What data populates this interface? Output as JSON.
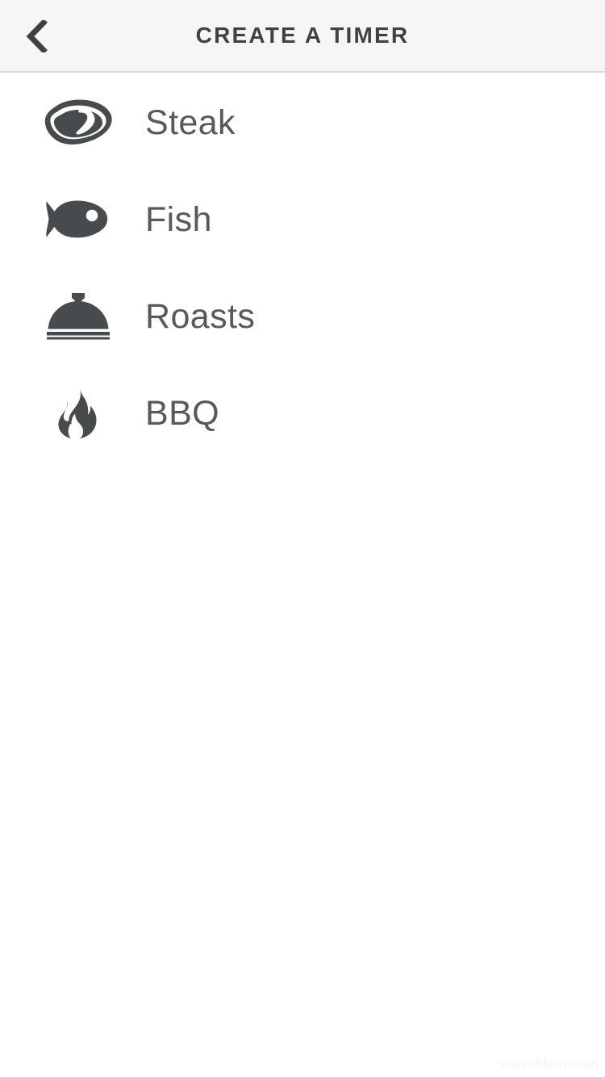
{
  "header": {
    "title": "CREATE A TIMER",
    "back_icon": "chevron-left-icon",
    "background_color": "#f6f6f6",
    "title_color": "#3f4245",
    "border_color": "#d9d9d9"
  },
  "list": {
    "items": [
      {
        "label": "Steak",
        "icon": "steak-icon",
        "icon_color": "#474b4e"
      },
      {
        "label": "Fish",
        "icon": "fish-icon",
        "icon_color": "#474b4e"
      },
      {
        "label": "Roasts",
        "icon": "cloche-icon",
        "icon_color": "#474b4e"
      },
      {
        "label": "BBQ",
        "icon": "flame-icon",
        "icon_color": "#474b4e"
      }
    ]
  },
  "watermark": {
    "text": "www.fifam.com",
    "color": "#f4f4f4"
  },
  "page": {
    "background_color": "#ffffff",
    "label_color": "#58595b"
  }
}
